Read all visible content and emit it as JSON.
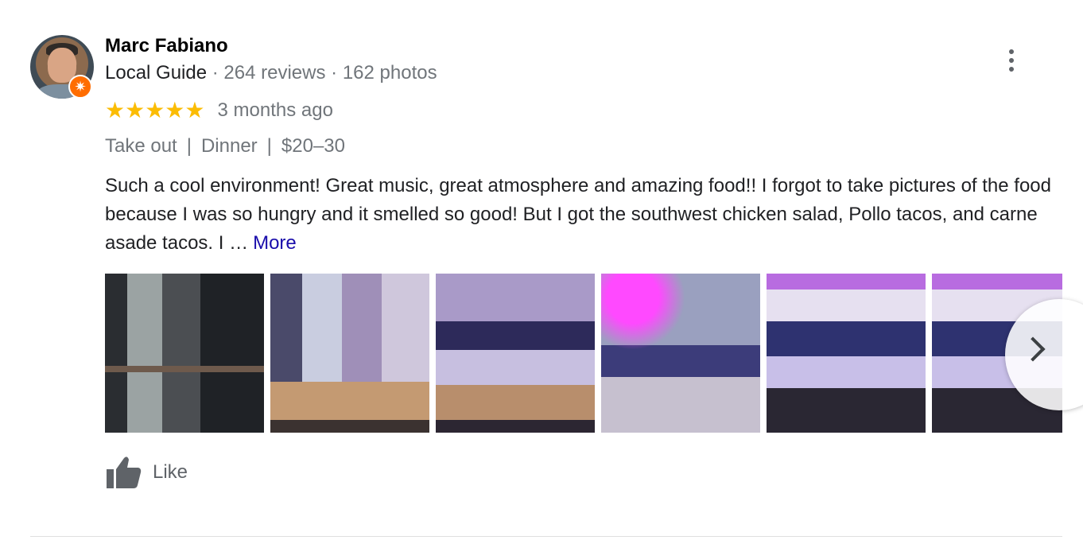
{
  "reviewer": {
    "name": "Marc Fabiano",
    "guide_label": "Local Guide",
    "reviews_count": "264 reviews",
    "photos_count": "162 photos",
    "separator": " · "
  },
  "review": {
    "rating": 5,
    "stars": "★★★★★",
    "time": "3 months ago",
    "attributes": [
      "Take out",
      "Dinner",
      "$20–30"
    ],
    "attribute_separator": "|",
    "text": "Such a cool environment! Great music, great atmosphere and amazing food!! I forgot to take pictures of the food because I was so hungry and it smelled so good! But I got the southwest chicken salad, Pollo tacos, and carne asade tacos. I …",
    "more_label": "More"
  },
  "photos": [
    {
      "name": "review-photo-1"
    },
    {
      "name": "review-photo-2"
    },
    {
      "name": "review-photo-3"
    },
    {
      "name": "review-photo-4"
    },
    {
      "name": "review-photo-5"
    },
    {
      "name": "review-photo-6"
    }
  ],
  "actions": {
    "like_label": "Like"
  },
  "icons": {
    "menu": "more-vert-icon",
    "like": "thumbs-up-icon",
    "next": "chevron-right-icon",
    "guide_badge": "local-guide-badge-icon"
  },
  "colors": {
    "star": "#fbbc04",
    "link": "#1a0dab",
    "badge": "#ff6d00",
    "muted": "#70757a"
  }
}
